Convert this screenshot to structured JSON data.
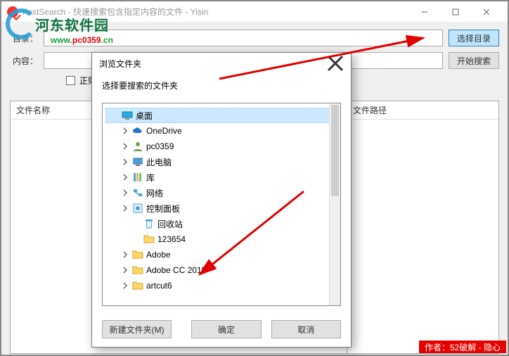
{
  "watermark": {
    "text": "河东软件园",
    "url_left": "www.",
    "url_mid": "pc0359",
    "url_right": ".cn"
  },
  "window": {
    "title": "FastSearch - 快速搜索包含指定内容的文件 - Yisin",
    "labels": {
      "dir": "目录：",
      "content": "内容："
    },
    "inputs": {
      "dir_value": "",
      "content_value": ""
    },
    "buttons": {
      "select_dir": "选择目录",
      "start_search": "开始搜索"
    },
    "options": {
      "regex_label": "正则"
    },
    "columns": {
      "name": "文件名称",
      "path": "文件路径"
    },
    "status": "作者：52破解 - 隐心"
  },
  "dialog": {
    "title": "浏览文件夹",
    "instruction": "选择要搜索的文件夹",
    "tree": [
      {
        "label": "桌面",
        "icon": "desktop",
        "indent": 0,
        "selected": true,
        "expandable": false
      },
      {
        "label": "OneDrive",
        "icon": "cloud",
        "indent": 1,
        "expandable": true
      },
      {
        "label": "pc0359",
        "icon": "user",
        "indent": 1,
        "expandable": true
      },
      {
        "label": "此电脑",
        "icon": "pc",
        "indent": 1,
        "expandable": true
      },
      {
        "label": "库",
        "icon": "lib",
        "indent": 1,
        "expandable": true
      },
      {
        "label": "网络",
        "icon": "net",
        "indent": 1,
        "expandable": true
      },
      {
        "label": "控制面板",
        "icon": "cpl",
        "indent": 1,
        "expandable": true
      },
      {
        "label": "回收站",
        "icon": "bin",
        "indent": 2,
        "expandable": false
      },
      {
        "label": "123654",
        "icon": "folder",
        "indent": 2,
        "expandable": false
      },
      {
        "label": "Adobe",
        "icon": "folder",
        "indent": 1,
        "expandable": true
      },
      {
        "label": "Adobe CC 2015",
        "icon": "folder",
        "indent": 1,
        "expandable": true
      },
      {
        "label": "artcut6",
        "icon": "folder",
        "indent": 1,
        "expandable": true
      }
    ],
    "buttons": {
      "new_folder": "新建文件夹(M)",
      "ok": "确定",
      "cancel": "取消"
    }
  }
}
